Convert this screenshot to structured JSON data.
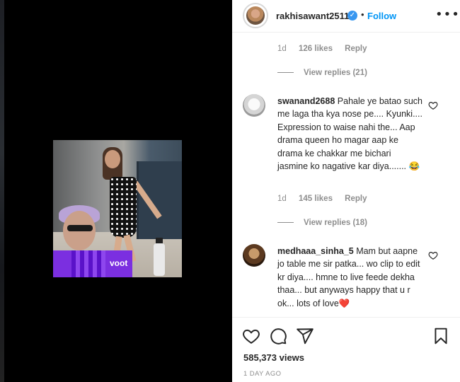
{
  "post": {
    "username": "rakhisawant2511",
    "verified_mark": "✓",
    "separator": "•",
    "follow_label": "Follow",
    "more_icon": "more-options-icon",
    "more_glyph": "•••"
  },
  "video": {
    "logo_text": "voot"
  },
  "comments": [
    {
      "meta": {
        "time": "1d",
        "likes": "126 likes",
        "reply": "Reply"
      },
      "view_replies": "View replies (21)"
    },
    {
      "username": "swanand2688",
      "text": "Pahale ye batao such me laga tha kya nose pe.... Kyunki.... Expression to waise nahi the... Aap drama queen ho magar aap ke drama ke chakkar me bichari jasmine ko nagative kar diya....... 😂",
      "meta": {
        "time": "1d",
        "likes": "145 likes",
        "reply": "Reply"
      },
      "view_replies": "View replies (18)"
    },
    {
      "username": "medhaaa_sinha_5",
      "text": "Mam but aapne jo table me sir patka... wo clip to edit kr diya.... hmne to live feede dekha thaa... but anyways happy that u r ok... lots of love❤️"
    }
  ],
  "actions": {
    "views": "585,373 views",
    "date": "1 DAY AGO"
  },
  "colors": {
    "accent": "#0095f6",
    "verified": "#3897f0",
    "muted": "#8e8e8e",
    "text": "#262626"
  }
}
